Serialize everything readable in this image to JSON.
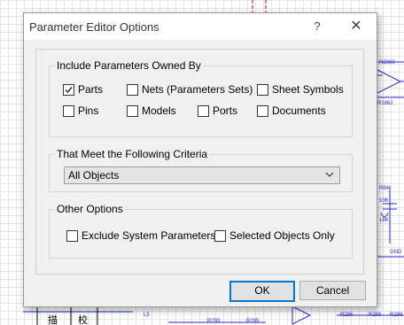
{
  "dialog": {
    "title": "Parameter Editor Options",
    "help_label": "?",
    "close_label": "✕"
  },
  "owned_by": {
    "title": "Include Parameters Owned By",
    "items": [
      {
        "label": "Parts",
        "checked": true
      },
      {
        "label": "Nets (Parameters Sets)",
        "checked": false
      },
      {
        "label": "Sheet Symbols",
        "checked": false
      },
      {
        "label": "Pins",
        "checked": false
      },
      {
        "label": "Models",
        "checked": false
      },
      {
        "label": "Ports",
        "checked": false
      },
      {
        "label": "Documents",
        "checked": false
      }
    ]
  },
  "criteria": {
    "title": "That Meet the Following Criteria",
    "selected": "All Objects"
  },
  "other": {
    "title": "Other Options",
    "items": [
      {
        "label": "Exclude System Parameters",
        "checked": false
      },
      {
        "label": "Selected Objects Only",
        "checked": false
      }
    ]
  },
  "buttons": {
    "ok": "OK",
    "cancel": "Cancel"
  },
  "schematic": {
    "labels": [
      "R2080",
      "R1862",
      "R84",
      "10K",
      "18K",
      "GND",
      "L5",
      "R293",
      "R295",
      "R296",
      "R298",
      "R299",
      "描",
      "校"
    ]
  }
}
